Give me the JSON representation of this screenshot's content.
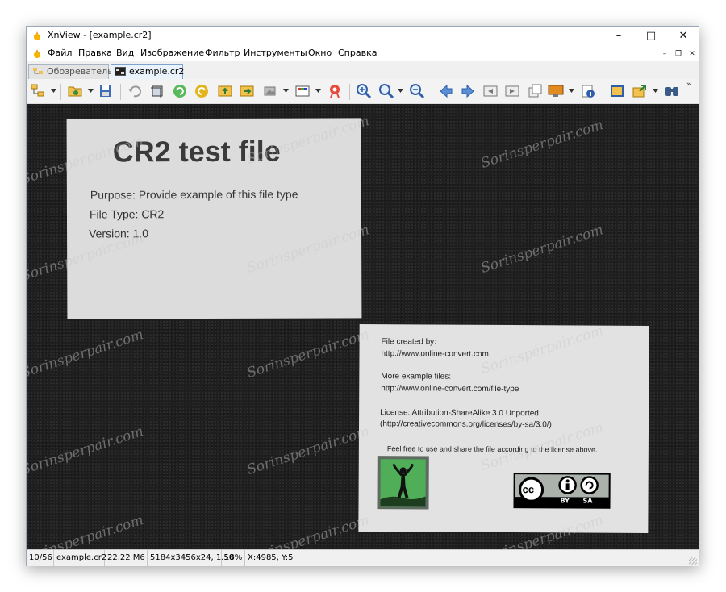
{
  "window": {
    "title": "XnView - [example.cr2]"
  },
  "menu": [
    "Файл",
    "Правка",
    "Вид",
    "Изображение",
    "Фильтр",
    "Инструменты",
    "Окно",
    "Справка"
  ],
  "tabs": [
    {
      "label": "Обозреватель",
      "active": false
    },
    {
      "label": "example.cr2",
      "active": true
    }
  ],
  "toolbar_icons": [
    "browser-icon",
    "open-folder-icon",
    "save-icon",
    "undo-icon",
    "crop-icon",
    "rotate-left-icon",
    "rotate-right-icon",
    "fit-icon",
    "slideshow-icon",
    "settings-icon",
    "color-icon",
    "redeye-icon",
    "zoom-in-icon",
    "zoom-menu-icon",
    "zoom-out-icon",
    "previous-icon",
    "next-icon",
    "first-icon",
    "last-icon",
    "copy-icon",
    "wallpaper-icon",
    "info-icon",
    "fullscreen-icon",
    "export-icon",
    "search-icon"
  ],
  "image": {
    "card1": {
      "title": "CR2 test file",
      "purpose": "Purpose: Provide example of this file type",
      "file_type": "File Type: CR2",
      "version": "Version: 1.0"
    },
    "card2": {
      "created_label": "File created by:",
      "created_url": "http://www.online-convert.com",
      "more_label": "More example files:",
      "more_url": "http://www.online-convert.com/file-type",
      "license": "License: Attribution-ShareAlike 3.0 Unported",
      "license_url": "(http://creativecommons.org/licenses/by-sa/3.0/)",
      "free_text": "Feel free to use and share the file according to the license above.",
      "cc": "cc",
      "by": "BY",
      "sa": "SA"
    },
    "watermark": "Sorinsperpair.com"
  },
  "status": {
    "index": "10/56",
    "filename": "example.cr2",
    "size": "22.22 M6",
    "dimensions": "5184x3456x24, 1.50",
    "zoom": "18%",
    "coords": "X:4985, Y:5"
  },
  "colors": {
    "viewer_bg": "#1f1f1f",
    "logo_green": "#4fae57",
    "accent": "#1e88e5"
  }
}
